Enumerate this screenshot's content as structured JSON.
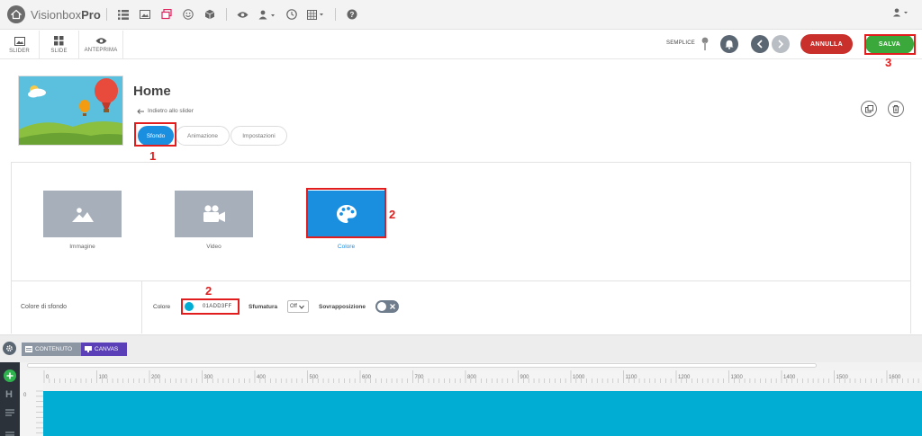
{
  "app": {
    "brand_light": "Visionbox",
    "brand_bold": "Pro"
  },
  "topbar": {
    "icons": [
      "list-icon",
      "image-icon",
      "layers-icon",
      "smiley-icon",
      "cube-icon",
      "eye-icon",
      "user-group-icon",
      "clock-icon",
      "grid-icon",
      "help-icon"
    ],
    "user_icon": "user-icon"
  },
  "toolbar": {
    "items": [
      {
        "label": "SLIDER",
        "icon": "image-icon"
      },
      {
        "label": "SLIDE",
        "icon": "grid-icon"
      },
      {
        "label": "ANTEPRIMA",
        "icon": "eye-icon"
      }
    ],
    "mode_label": "SEMPLICE",
    "cancel_label": "ANNULLA",
    "save_label": "SALVA"
  },
  "header": {
    "title": "Home",
    "back_link": "Indietro allo slider",
    "tabs": [
      {
        "label": "Sfondo",
        "active": true
      },
      {
        "label": "Animazione",
        "active": false
      },
      {
        "label": "Impostazioni",
        "active": false
      }
    ]
  },
  "background_options": [
    {
      "label": "Immagine",
      "icon": "image-icon",
      "selected": false
    },
    {
      "label": "Video",
      "icon": "video-camera-icon",
      "selected": false
    },
    {
      "label": "Colore",
      "icon": "palette-icon",
      "selected": true
    }
  ],
  "background_settings": {
    "row_label": "Colore di sfondo",
    "color_label": "Colore",
    "color_value": "01ADD3FF",
    "gradient_label": "Sfumatura",
    "gradient_value": "Off",
    "overlay_label": "Sovrapposizione",
    "overlay_on": false
  },
  "steps": {
    "one": "1",
    "two_a": "2",
    "two_b": "2",
    "three": "3"
  },
  "editor": {
    "tab_content": "CONTENUTO",
    "tab_canvas": "CANVAS",
    "rail_heading": "H",
    "ruler_labels": [
      "0",
      "100",
      "200",
      "300",
      "400",
      "500",
      "600",
      "700",
      "800",
      "900",
      "1000",
      "1100",
      "1200",
      "1300",
      "1400",
      "1500",
      "1600"
    ],
    "vruler_label": "0"
  },
  "colors": {
    "accent_blue": "#1a8fe0",
    "cancel_red": "#c9302c",
    "save_green": "#3aa83a",
    "canvas_color": "#01ADD3",
    "highlight_red": "#e21d1d"
  }
}
